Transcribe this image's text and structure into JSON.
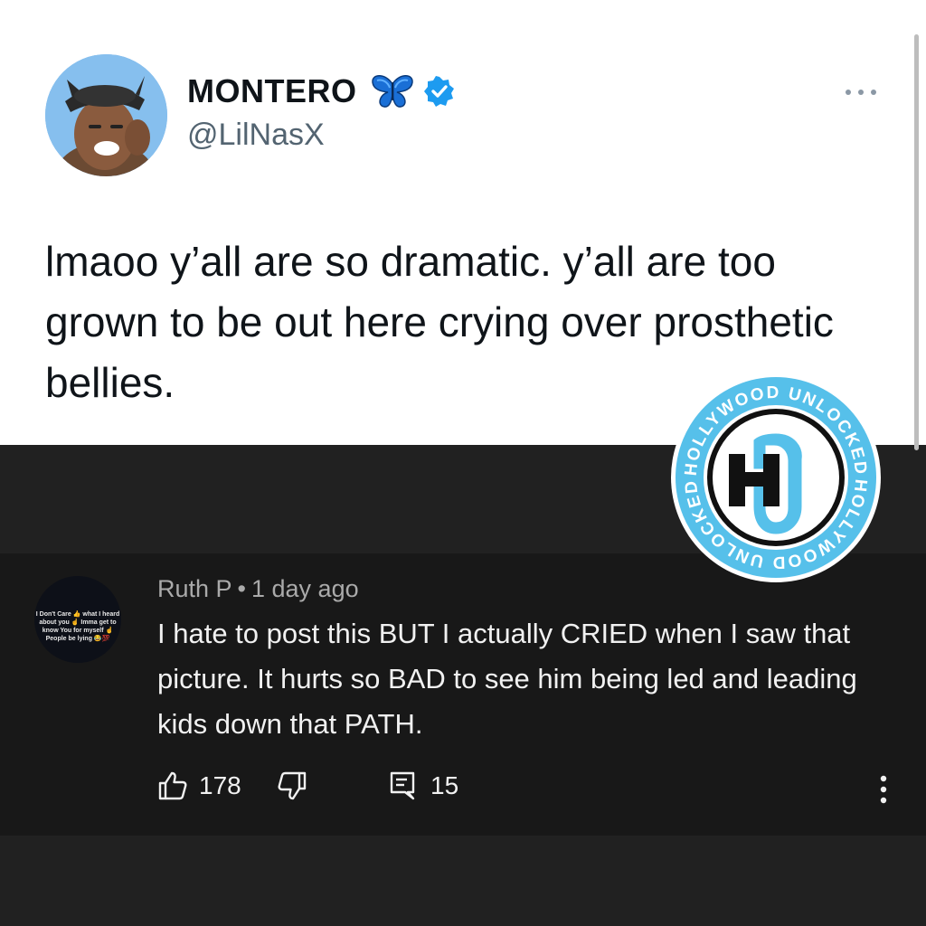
{
  "tweet": {
    "display_name": "MONTERO",
    "handle": "@LilNasX",
    "text": "lmaoo y’all are so dramatic. y’all are too grown to be out here crying over prosthetic bellies.",
    "icons": {
      "butterfly": "butterfly-emoji-icon",
      "verified": "verified-badge-icon",
      "more": "more-options-icon"
    },
    "colors": {
      "verified": "#1d9bf0",
      "text": "#0f1419",
      "handle": "#536471"
    }
  },
  "comment": {
    "author": "Ruth P",
    "separator": "•",
    "time": "1 day ago",
    "text": "I hate to post this BUT I actually CRIED when I saw that picture. It hurts so BAD to see him being led and leading kids down that PATH.",
    "avatar_text": "I Don't Care 👍 what I heard about you ☝️ Imma get to know You for myself ☝️ People be lying 😂💯",
    "likes": "178",
    "replies": "15",
    "icons": {
      "like": "thumbs-up-icon",
      "dislike": "thumbs-down-icon",
      "reply": "reply-comment-icon",
      "more": "vertical-dots-icon"
    }
  },
  "watermark": {
    "text_top": "HOLLYWOOD UNLOCKED",
    "text_bottom": "HOLLYWOOD UNLOCKED",
    "monogram": "HU",
    "color": "#56c0ea"
  }
}
